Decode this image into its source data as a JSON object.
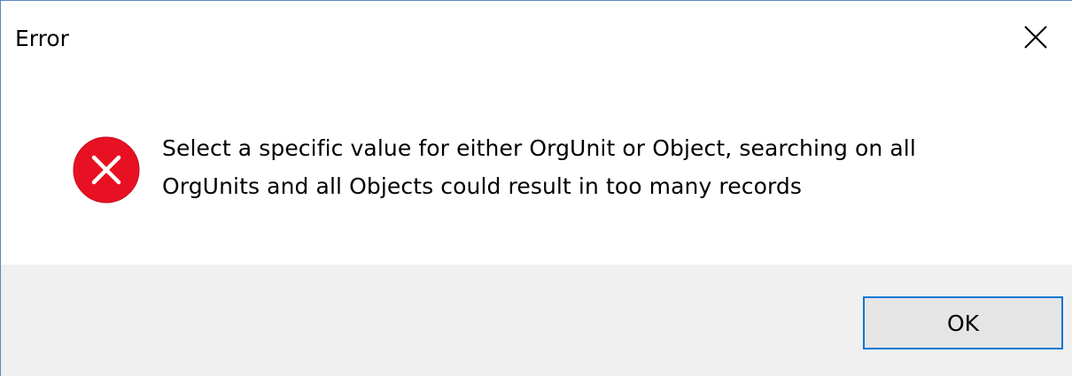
{
  "dialog": {
    "title": "Error",
    "message_line1": "Select a specific value for either OrgUnit or Object, searching on all",
    "message_line2": "OrgUnits and all Objects could result in too many records",
    "icon": "error-icon",
    "ok_label": "OK"
  },
  "colors": {
    "accent": "#0078d7",
    "error_red": "#e81123",
    "footer_bg": "#f0f0f0"
  }
}
